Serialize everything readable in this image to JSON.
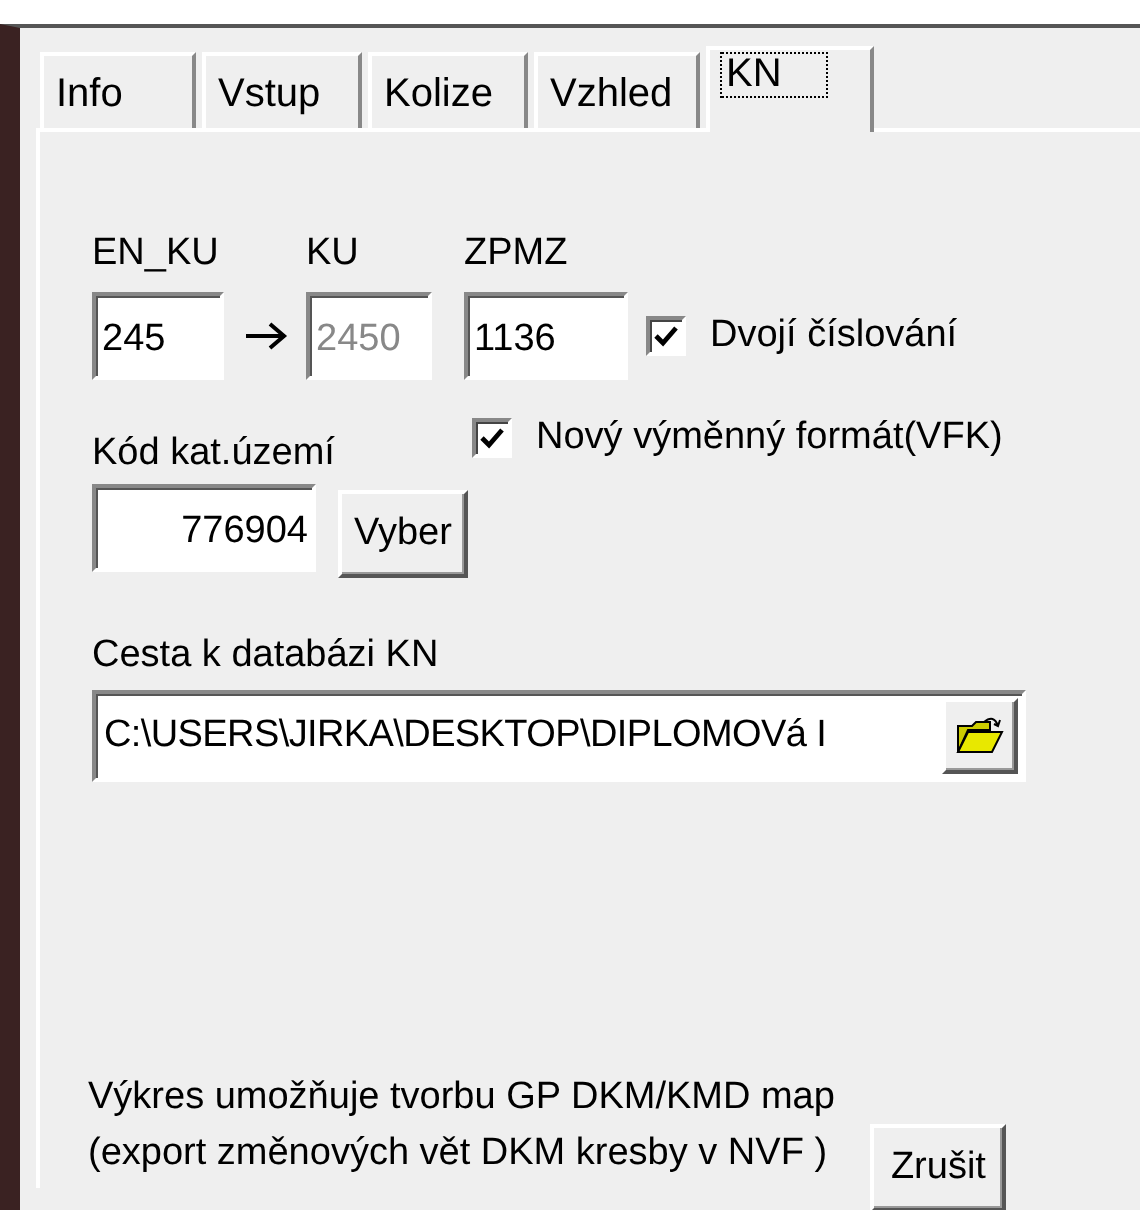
{
  "tabs": [
    {
      "label": "Info",
      "selected": false
    },
    {
      "label": "Vstup",
      "selected": false
    },
    {
      "label": "Kolize",
      "selected": false
    },
    {
      "label": "Vzhled",
      "selected": false
    },
    {
      "label": "KN",
      "selected": true
    }
  ],
  "kn": {
    "en_ku": {
      "label": "EN_KU",
      "value": "245"
    },
    "ku": {
      "label": "KU",
      "value": "2450",
      "disabled": true
    },
    "zpmz": {
      "label": "ZPMZ",
      "value": "1136"
    },
    "double_numbering": {
      "label": "Dvojí číslování",
      "checked": true
    },
    "cadastral_code": {
      "label": "Kód kat.území",
      "value": "776904"
    },
    "select_button": "Vyber",
    "new_format": {
      "label": "Nový výměnný formát(VFK)",
      "checked": true
    },
    "db_path": {
      "label": "Cesta k databázi KN",
      "value": "C:\\USERS\\JIRKA\\DESKTOP\\DIPLOMOVá I"
    },
    "info_lines": [
      "Výkres umožňuje tvorbu GP DKM/KMD map",
      "(export změnových vět DKM kresby v NVF )"
    ],
    "cancel_button": "Zrušit"
  }
}
